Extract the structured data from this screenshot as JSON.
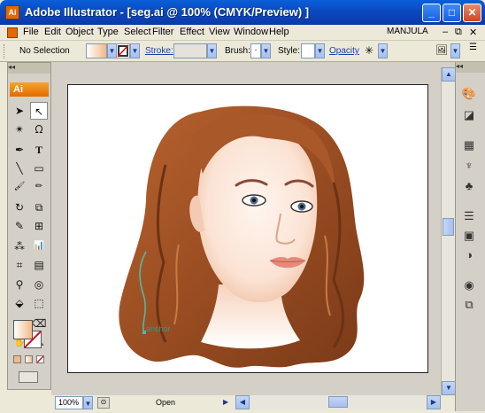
{
  "window": {
    "app_icon": "Ai",
    "title": "Adobe Illustrator - [seg.ai @ 100% (CMYK/Preview) ]",
    "minimize": "_",
    "maximize": "□",
    "close": "✕"
  },
  "menu": {
    "items": [
      "File",
      "Edit",
      "Object",
      "Type",
      "Select",
      "Filter",
      "Effect",
      "View",
      "Window",
      "Help"
    ],
    "user": "MANJULA",
    "doc_controls": [
      "–",
      "⧉",
      "✕"
    ]
  },
  "control_bar": {
    "selection": "No Selection",
    "stroke_label": "Stroke:",
    "brush_label": "Brush:",
    "brush_value": "·",
    "style_label": "Style:",
    "opacity_label": "Opacity",
    "dropdown_arrow": "▼"
  },
  "tools": {
    "header": "◂◂",
    "logo": "Ai",
    "icons": {
      "selection": "➤",
      "direct_selection": "↖",
      "magic_wand": "✴",
      "lasso": "ᘯ",
      "pen": "✒",
      "type": "T",
      "line": "╲",
      "rectangle": "▭",
      "paintbrush": "🖌",
      "pencil": "✏",
      "rotate": "↻",
      "scale": "⧉",
      "warp": "✎",
      "free_transform": "⊞",
      "symbol_sprayer": "⁂",
      "graph": "📊",
      "mesh": "⌗",
      "gradient": "▤",
      "eyedropper": "⚲",
      "blend": "◎",
      "live_paint": "⬙",
      "live_paint_select": "⬚",
      "slice": "✂",
      "eraser": "⌫",
      "hand": "✋",
      "zoom": "🔍"
    }
  },
  "canvas": {
    "annotation": "anchor"
  },
  "right_panel": {
    "header": "◂◂",
    "buttons": [
      "🎨",
      "◪",
      "▦",
      "♆",
      "♣",
      "☰",
      "▣",
      "◑",
      "◉",
      "⧉"
    ]
  },
  "status": {
    "zoom": "100%",
    "mode": "Open"
  },
  "colors": {
    "titlebar": "#0b49c0",
    "ai_orange": "#e26a00",
    "hair": "#a0542a",
    "skin": "#fbe5d8",
    "lips": "#e89080",
    "anchor": "#4fb8a8"
  }
}
